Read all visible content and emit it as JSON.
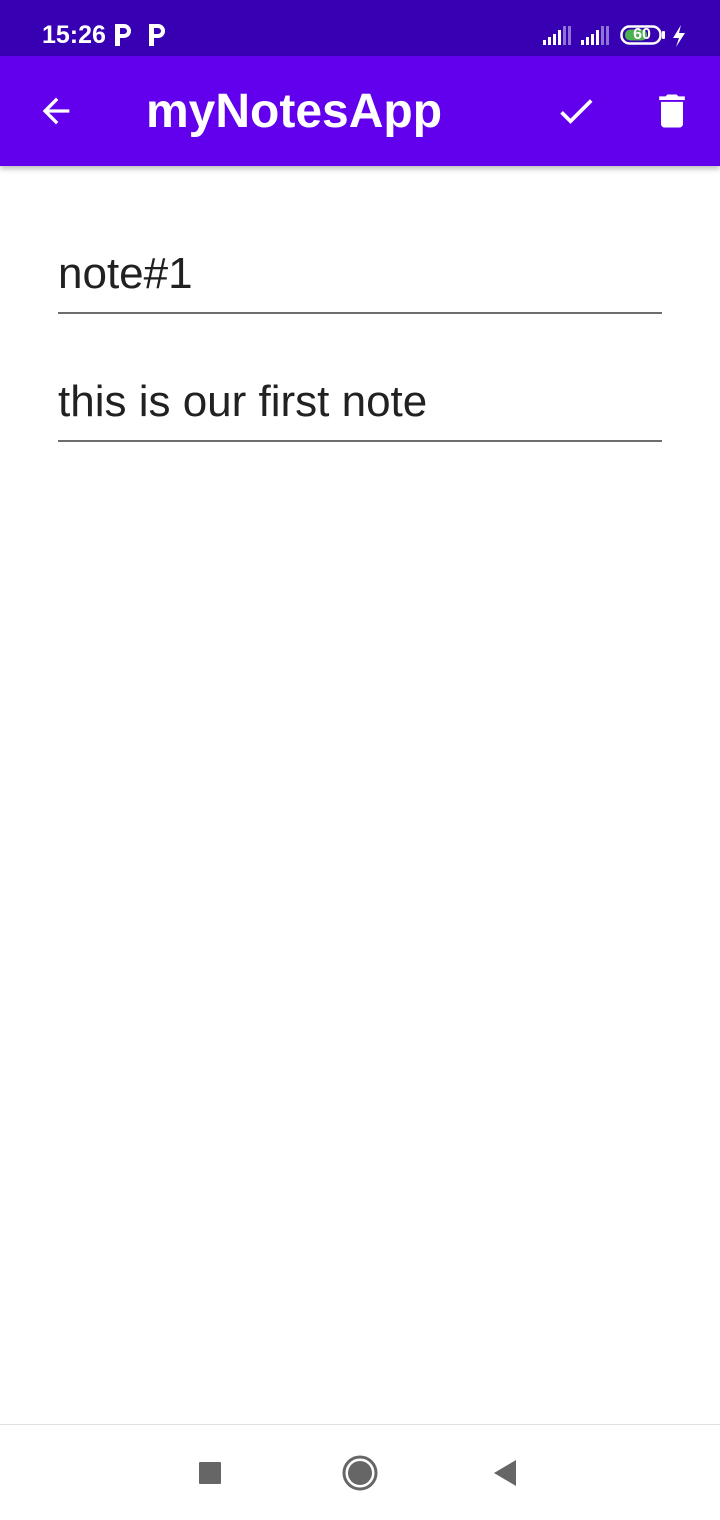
{
  "status_bar": {
    "time": "15:26",
    "notification_icons": [
      "p-icon",
      "p-icon"
    ],
    "battery_level": "60",
    "charging": true
  },
  "app_bar": {
    "title": "myNotesApp",
    "icons": {
      "back": "arrow-left-icon",
      "save": "check-icon",
      "delete": "trash-icon"
    },
    "background_color": "#6200ee",
    "status_color": "#3700b3"
  },
  "note": {
    "title_value": "note#1",
    "body_value": "this is our first note"
  },
  "nav_bar": {
    "icons": {
      "recents": "square-icon",
      "home": "circle-icon",
      "back": "triangle-left-icon"
    }
  }
}
